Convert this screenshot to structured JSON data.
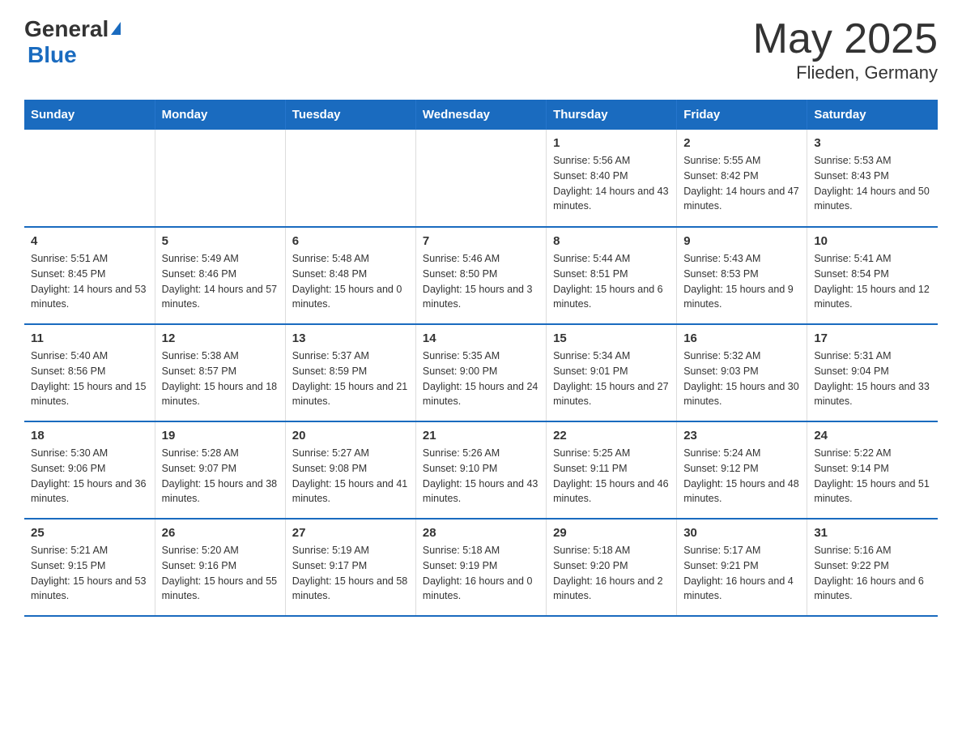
{
  "header": {
    "logo_general": "General",
    "logo_blue": "Blue",
    "title": "May 2025",
    "subtitle": "Flieden, Germany"
  },
  "days_of_week": [
    "Sunday",
    "Monday",
    "Tuesday",
    "Wednesday",
    "Thursday",
    "Friday",
    "Saturday"
  ],
  "weeks": [
    [
      {
        "day": "",
        "info": ""
      },
      {
        "day": "",
        "info": ""
      },
      {
        "day": "",
        "info": ""
      },
      {
        "day": "",
        "info": ""
      },
      {
        "day": "1",
        "info": "Sunrise: 5:56 AM\nSunset: 8:40 PM\nDaylight: 14 hours and 43 minutes."
      },
      {
        "day": "2",
        "info": "Sunrise: 5:55 AM\nSunset: 8:42 PM\nDaylight: 14 hours and 47 minutes."
      },
      {
        "day": "3",
        "info": "Sunrise: 5:53 AM\nSunset: 8:43 PM\nDaylight: 14 hours and 50 minutes."
      }
    ],
    [
      {
        "day": "4",
        "info": "Sunrise: 5:51 AM\nSunset: 8:45 PM\nDaylight: 14 hours and 53 minutes."
      },
      {
        "day": "5",
        "info": "Sunrise: 5:49 AM\nSunset: 8:46 PM\nDaylight: 14 hours and 57 minutes."
      },
      {
        "day": "6",
        "info": "Sunrise: 5:48 AM\nSunset: 8:48 PM\nDaylight: 15 hours and 0 minutes."
      },
      {
        "day": "7",
        "info": "Sunrise: 5:46 AM\nSunset: 8:50 PM\nDaylight: 15 hours and 3 minutes."
      },
      {
        "day": "8",
        "info": "Sunrise: 5:44 AM\nSunset: 8:51 PM\nDaylight: 15 hours and 6 minutes."
      },
      {
        "day": "9",
        "info": "Sunrise: 5:43 AM\nSunset: 8:53 PM\nDaylight: 15 hours and 9 minutes."
      },
      {
        "day": "10",
        "info": "Sunrise: 5:41 AM\nSunset: 8:54 PM\nDaylight: 15 hours and 12 minutes."
      }
    ],
    [
      {
        "day": "11",
        "info": "Sunrise: 5:40 AM\nSunset: 8:56 PM\nDaylight: 15 hours and 15 minutes."
      },
      {
        "day": "12",
        "info": "Sunrise: 5:38 AM\nSunset: 8:57 PM\nDaylight: 15 hours and 18 minutes."
      },
      {
        "day": "13",
        "info": "Sunrise: 5:37 AM\nSunset: 8:59 PM\nDaylight: 15 hours and 21 minutes."
      },
      {
        "day": "14",
        "info": "Sunrise: 5:35 AM\nSunset: 9:00 PM\nDaylight: 15 hours and 24 minutes."
      },
      {
        "day": "15",
        "info": "Sunrise: 5:34 AM\nSunset: 9:01 PM\nDaylight: 15 hours and 27 minutes."
      },
      {
        "day": "16",
        "info": "Sunrise: 5:32 AM\nSunset: 9:03 PM\nDaylight: 15 hours and 30 minutes."
      },
      {
        "day": "17",
        "info": "Sunrise: 5:31 AM\nSunset: 9:04 PM\nDaylight: 15 hours and 33 minutes."
      }
    ],
    [
      {
        "day": "18",
        "info": "Sunrise: 5:30 AM\nSunset: 9:06 PM\nDaylight: 15 hours and 36 minutes."
      },
      {
        "day": "19",
        "info": "Sunrise: 5:28 AM\nSunset: 9:07 PM\nDaylight: 15 hours and 38 minutes."
      },
      {
        "day": "20",
        "info": "Sunrise: 5:27 AM\nSunset: 9:08 PM\nDaylight: 15 hours and 41 minutes."
      },
      {
        "day": "21",
        "info": "Sunrise: 5:26 AM\nSunset: 9:10 PM\nDaylight: 15 hours and 43 minutes."
      },
      {
        "day": "22",
        "info": "Sunrise: 5:25 AM\nSunset: 9:11 PM\nDaylight: 15 hours and 46 minutes."
      },
      {
        "day": "23",
        "info": "Sunrise: 5:24 AM\nSunset: 9:12 PM\nDaylight: 15 hours and 48 minutes."
      },
      {
        "day": "24",
        "info": "Sunrise: 5:22 AM\nSunset: 9:14 PM\nDaylight: 15 hours and 51 minutes."
      }
    ],
    [
      {
        "day": "25",
        "info": "Sunrise: 5:21 AM\nSunset: 9:15 PM\nDaylight: 15 hours and 53 minutes."
      },
      {
        "day": "26",
        "info": "Sunrise: 5:20 AM\nSunset: 9:16 PM\nDaylight: 15 hours and 55 minutes."
      },
      {
        "day": "27",
        "info": "Sunrise: 5:19 AM\nSunset: 9:17 PM\nDaylight: 15 hours and 58 minutes."
      },
      {
        "day": "28",
        "info": "Sunrise: 5:18 AM\nSunset: 9:19 PM\nDaylight: 16 hours and 0 minutes."
      },
      {
        "day": "29",
        "info": "Sunrise: 5:18 AM\nSunset: 9:20 PM\nDaylight: 16 hours and 2 minutes."
      },
      {
        "day": "30",
        "info": "Sunrise: 5:17 AM\nSunset: 9:21 PM\nDaylight: 16 hours and 4 minutes."
      },
      {
        "day": "31",
        "info": "Sunrise: 5:16 AM\nSunset: 9:22 PM\nDaylight: 16 hours and 6 minutes."
      }
    ]
  ]
}
